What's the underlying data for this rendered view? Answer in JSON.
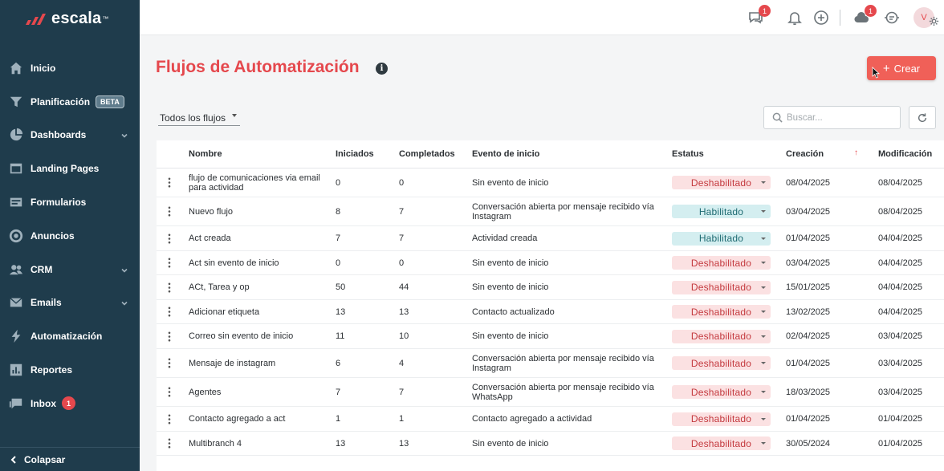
{
  "brand": {
    "name": "escala",
    "tm": "™"
  },
  "sidebar": {
    "items": [
      {
        "label": "Inicio",
        "icon": "home-icon"
      },
      {
        "label": "Planificación",
        "icon": "funnel-icon",
        "badge": "BETA"
      },
      {
        "label": "Dashboards",
        "icon": "pie-chart-icon",
        "expandable": true
      },
      {
        "label": "Landing Pages",
        "icon": "landing-page-icon"
      },
      {
        "label": "Formularios",
        "icon": "form-icon"
      },
      {
        "label": "Anuncios",
        "icon": "target-icon"
      },
      {
        "label": "CRM",
        "icon": "users-icon",
        "expandable": true
      },
      {
        "label": "Emails",
        "icon": "envelope-icon",
        "expandable": true
      },
      {
        "label": "Automatización",
        "icon": "lightning-icon"
      },
      {
        "label": "Reportes",
        "icon": "bar-chart-icon"
      },
      {
        "label": "Inbox",
        "icon": "inbox-icon",
        "count": "1"
      }
    ],
    "collapse_label": "Colapsar"
  },
  "topbar": {
    "chat_badge": "1",
    "cloud_badge": "1",
    "avatar_initial": "V"
  },
  "page": {
    "title": "Flujos de Automatización",
    "info": "i",
    "create_label": "Crear",
    "create_plus": "+",
    "filter_label": "Todos los flujos",
    "search_placeholder": "Buscar...",
    "sort_arrow": "↑"
  },
  "table": {
    "headers": {
      "name": "Nombre",
      "started": "Iniciados",
      "completed": "Completados",
      "event": "Evento de inicio",
      "status": "Estatus",
      "created": "Creación",
      "modified": "Modificación"
    },
    "rows": [
      {
        "name": "flujo de comunicaciones via email para actividad",
        "started": "0",
        "completed": "0",
        "event": "Sin evento de inicio",
        "status": "Deshabilitado",
        "enabled": false,
        "created": "08/04/2025",
        "modified": "08/04/2025"
      },
      {
        "name": "Nuevo flujo",
        "started": "8",
        "completed": "7",
        "event": "Conversación abierta por mensaje recibido vía Instagram",
        "status": "Habilitado",
        "enabled": true,
        "created": "03/04/2025",
        "modified": "08/04/2025"
      },
      {
        "name": "Act creada",
        "started": "7",
        "completed": "7",
        "event": "Actividad creada",
        "status": "Habilitado",
        "enabled": true,
        "created": "01/04/2025",
        "modified": "04/04/2025"
      },
      {
        "name": "Act sin evento de inicio",
        "started": "0",
        "completed": "0",
        "event": "Sin evento de inicio",
        "status": "Deshabilitado",
        "enabled": false,
        "created": "03/04/2025",
        "modified": "04/04/2025"
      },
      {
        "name": "ACt, Tarea y op",
        "started": "50",
        "completed": "44",
        "event": "Sin evento de inicio",
        "status": "Deshabilitado",
        "enabled": false,
        "created": "15/01/2025",
        "modified": "04/04/2025"
      },
      {
        "name": "Adicionar etiqueta",
        "started": "13",
        "completed": "13",
        "event": "Contacto actualizado",
        "status": "Deshabilitado",
        "enabled": false,
        "created": "13/02/2025",
        "modified": "04/04/2025"
      },
      {
        "name": "Correo sin evento de inicio",
        "started": "11",
        "completed": "10",
        "event": "Sin evento de inicio",
        "status": "Deshabilitado",
        "enabled": false,
        "created": "02/04/2025",
        "modified": "03/04/2025"
      },
      {
        "name": "Mensaje de instagram",
        "started": "6",
        "completed": "4",
        "event": "Conversación abierta por mensaje recibido vía Instagram",
        "status": "Deshabilitado",
        "enabled": false,
        "created": "01/04/2025",
        "modified": "03/04/2025"
      },
      {
        "name": "Agentes",
        "started": "7",
        "completed": "7",
        "event": "Conversación abierta por mensaje recibido vía WhatsApp",
        "status": "Deshabilitado",
        "enabled": false,
        "created": "18/03/2025",
        "modified": "03/04/2025"
      },
      {
        "name": "Contacto agregado a act",
        "started": "1",
        "completed": "1",
        "event": "Contacto agregado a actividad",
        "status": "Deshabilitado",
        "enabled": false,
        "created": "01/04/2025",
        "modified": "01/04/2025"
      },
      {
        "name": "Multibranch 4",
        "started": "13",
        "completed": "13",
        "event": "Sin evento de inicio",
        "status": "Deshabilitado",
        "enabled": false,
        "created": "30/05/2024",
        "modified": "01/04/2025"
      }
    ]
  },
  "colors": {
    "brand_red": "#e5484d",
    "sidebar_bg": "#1f3c4c",
    "enabled_bg": "#d4eef0",
    "disabled_bg": "#fbe1e2"
  }
}
